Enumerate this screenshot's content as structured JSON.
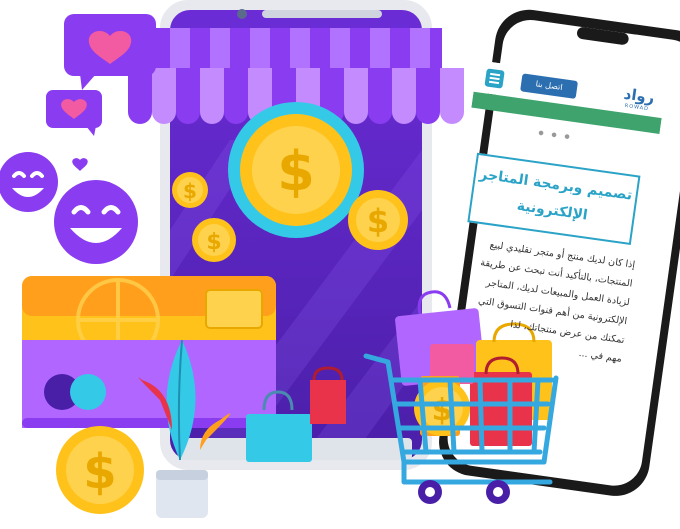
{
  "phone": {
    "brand_name": "رواد",
    "brand_sub": "ROWAD",
    "contact_button": "اتصل بنا",
    "heading_line1": "تصميم وبرمجة المتاجر",
    "heading_line2": "الإلكترونية",
    "body_lines": [
      "إذا كان لديك منتج أو متجر تقليدي لبيع",
      "المنتجات، بالتأكيد أنت تبحث عن طريقة",
      "لزيادة العمل والمبيعات لديك، المتاجر",
      "الإلكترونية من أهم قنوات التسوق التي",
      "تمكنك من عرض منتجاتك، لذا",
      "مهم في ..."
    ]
  },
  "icons": {
    "heart_bubbles": [
      "heart-icon",
      "heart-icon"
    ],
    "coins": [
      "dollar-icon",
      "dollar-icon",
      "dollar-icon",
      "dollar-icon"
    ],
    "smileys": [
      "smiley-icon",
      "smiley-icon"
    ]
  },
  "colors": {
    "purple": "#8a3cf0",
    "deep_purple": "#4a1fa8",
    "gold": "#ffc21a",
    "orange": "#ff9f1c",
    "cyan": "#35c9e8",
    "pink": "#f25aa2",
    "red": "#e8334a",
    "green_bar": "#3ea36d",
    "blue": "#2c6fb0"
  }
}
